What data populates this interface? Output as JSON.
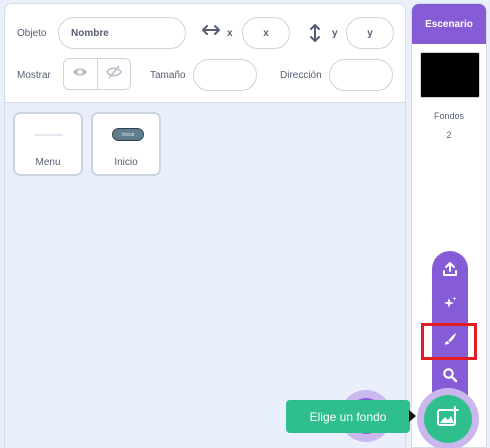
{
  "sprite_info": {
    "sprite_label": "Objeto",
    "name_placeholder": "Nombre",
    "x_label": "x",
    "x_placeholder": "x",
    "y_label": "y",
    "y_placeholder": "y",
    "show_label": "Mostrar",
    "size_label": "Tamaño",
    "direction_label": "Dirección"
  },
  "sprites": [
    {
      "name": "Menu"
    },
    {
      "name": "Inicio",
      "thumb_text": "Iniciar"
    }
  ],
  "stage": {
    "header": "Escenario",
    "backdrops_label": "Fondos",
    "backdrops_count": "2"
  },
  "tooltip": {
    "text": "Elige un fondo"
  },
  "menu_icons": [
    "upload-icon",
    "surprise-icon",
    "paint-icon",
    "search-icon"
  ],
  "colors": {
    "accent": "#855cd6",
    "action": "#2fbf8c",
    "highlight": "#e31b23"
  }
}
